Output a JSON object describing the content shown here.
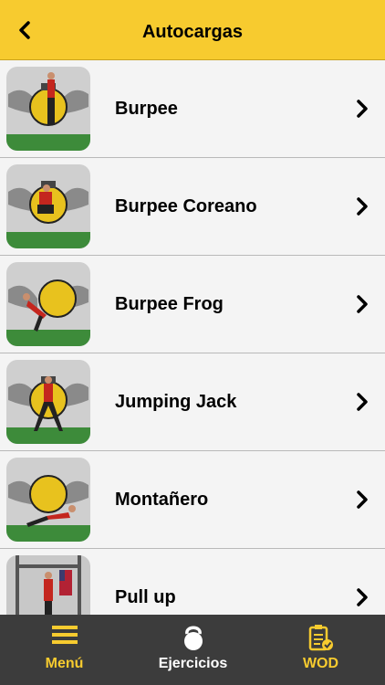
{
  "header": {
    "title": "Autocargas",
    "back_icon": "chevron-left-icon"
  },
  "exercises": [
    {
      "label": "Burpee",
      "thumb": "burpee-photo"
    },
    {
      "label": "Burpee Coreano",
      "thumb": "burpee-coreano-photo"
    },
    {
      "label": "Burpee Frog",
      "thumb": "burpee-frog-photo"
    },
    {
      "label": "Jumping Jack",
      "thumb": "jumping-jack-photo"
    },
    {
      "label": "Montañero",
      "thumb": "montanero-photo"
    },
    {
      "label": "Pull up",
      "thumb": "pull-up-photo"
    }
  ],
  "tabbar": {
    "tabs": [
      {
        "label": "Menú",
        "icon": "menu-icon"
      },
      {
        "label": "Ejercicios",
        "icon": "kettlebell-icon"
      },
      {
        "label": "WOD",
        "icon": "clipboard-check-icon"
      }
    ]
  },
  "colors": {
    "accent": "#f7cb2f",
    "tabbar": "#3c3c3c",
    "row": "#f4f4f4"
  }
}
